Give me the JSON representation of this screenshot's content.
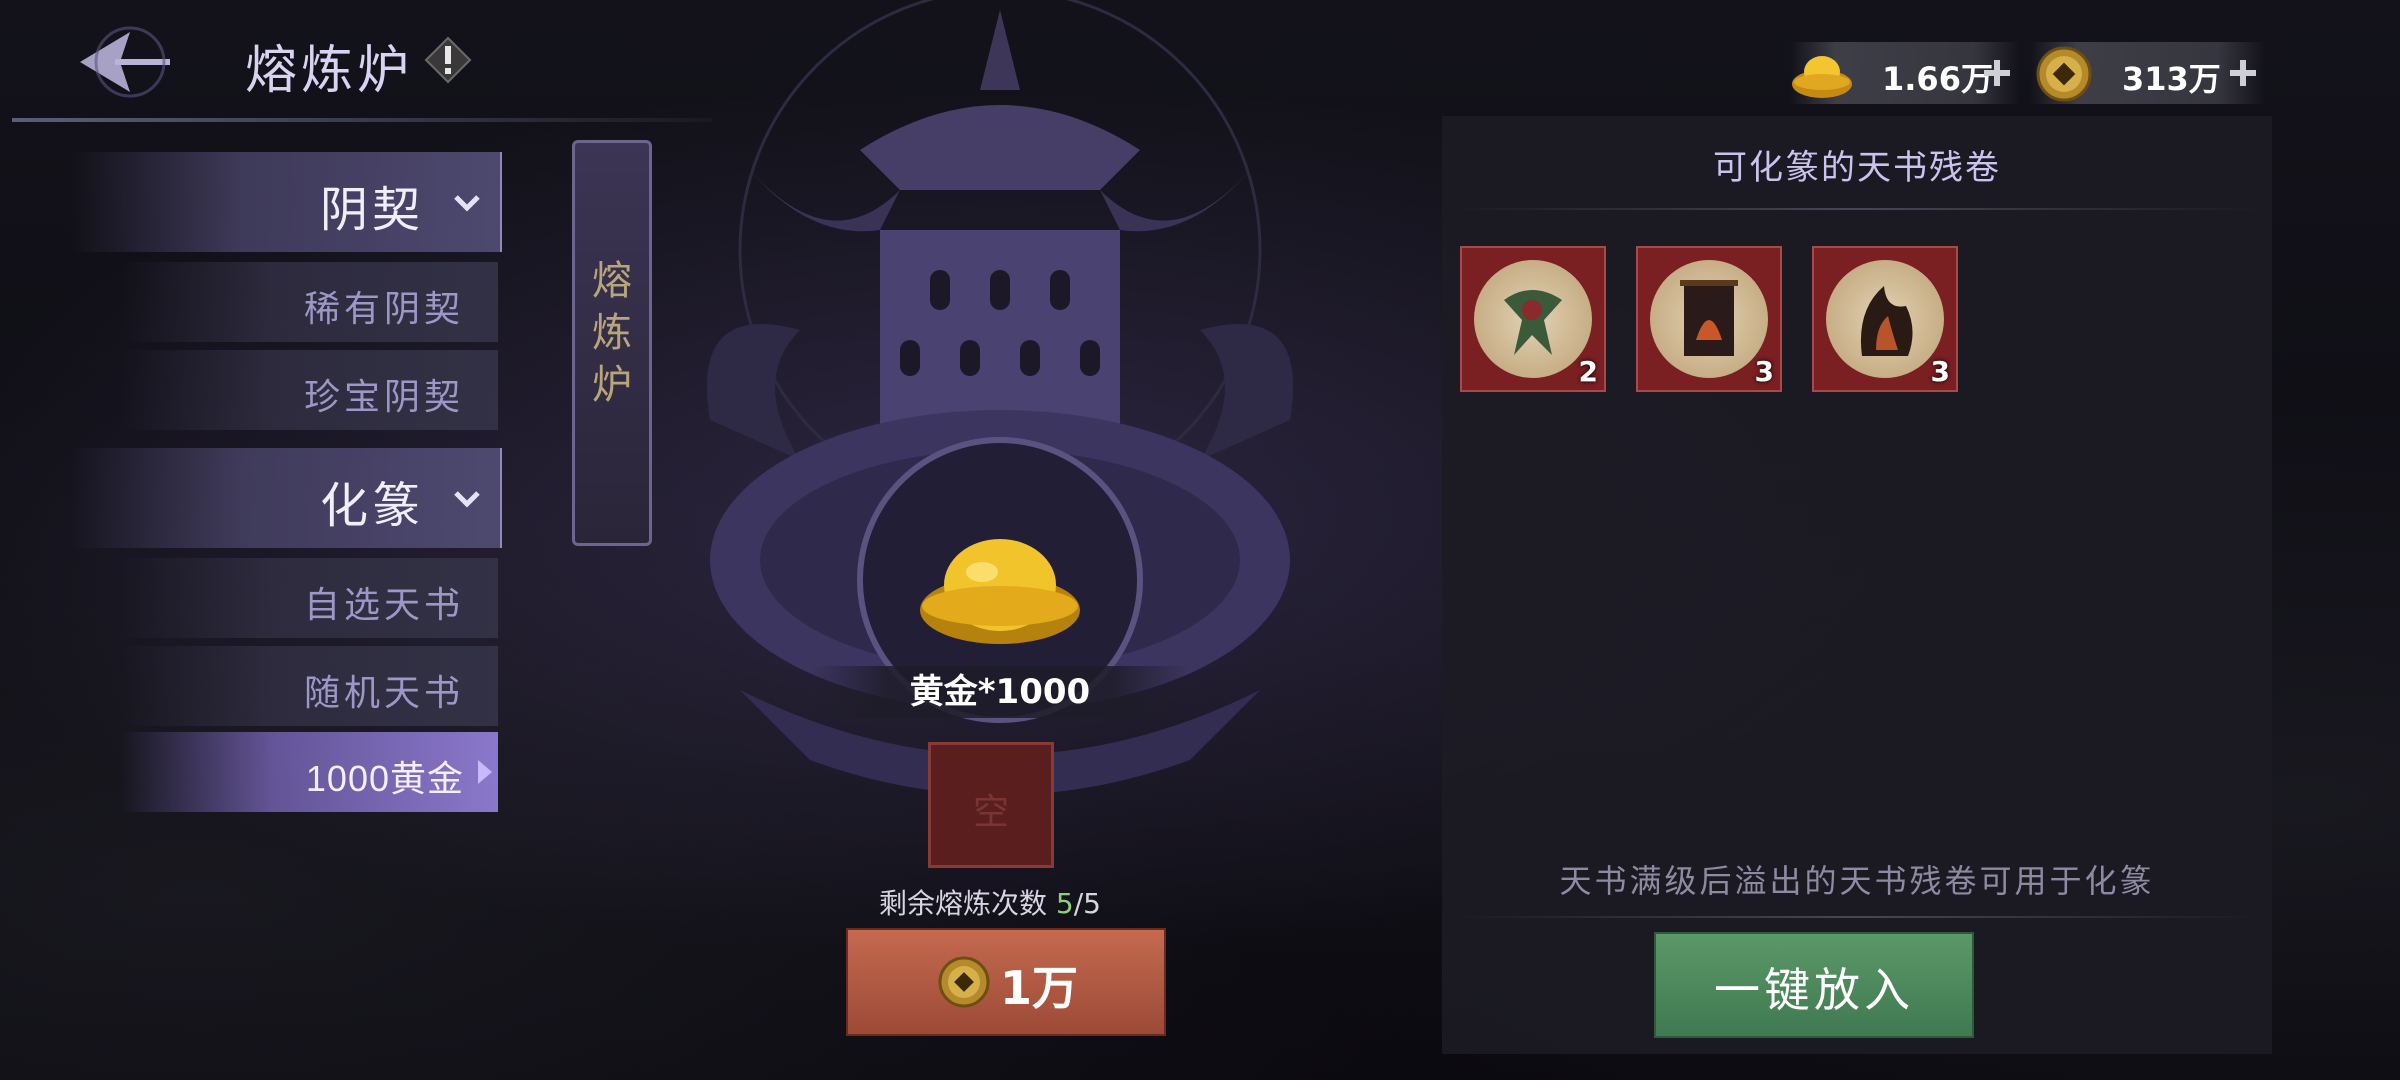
{
  "header": {
    "title": "熔炼炉",
    "info_icon": "exclamation-icon",
    "back_icon": "back-arrow-icon"
  },
  "currency": {
    "gold": {
      "value": "1.66万",
      "icon": "gold-ingot-icon"
    },
    "coin": {
      "value": "313万",
      "icon": "copper-coin-icon"
    }
  },
  "sidebar": {
    "categories": [
      {
        "label": "阴契",
        "items": [
          {
            "label": "稀有阴契"
          },
          {
            "label": "珍宝阴契"
          }
        ]
      },
      {
        "label": "化篆",
        "items": [
          {
            "label": "自选天书"
          },
          {
            "label": "随机天书"
          },
          {
            "label": "1000黄金",
            "selected": true
          }
        ]
      }
    ]
  },
  "furnace": {
    "tab_label": "熔炼炉",
    "reward_label": "黄金*1000",
    "empty_slot_label": "空",
    "remaining_label": "剩余熔炼次数",
    "remaining_current": "5",
    "remaining_total": "/5",
    "smelt_cost": "1万"
  },
  "panel": {
    "title": "可化篆的天书残卷",
    "items": [
      {
        "icon": "scroll-fragment-bird-icon",
        "count": "2"
      },
      {
        "icon": "scroll-fragment-banner-icon",
        "count": "3"
      },
      {
        "icon": "scroll-fragment-flame-icon",
        "count": "3"
      }
    ],
    "hint": "天书满级后溢出的天书残卷可用于化篆",
    "put_all_button": "一键放入"
  },
  "colors": {
    "accent_purple": "#8f8ab8",
    "smelt_button": "#b35c44",
    "put_button": "#4d8a5c",
    "item_bg": "#7a1f22"
  }
}
